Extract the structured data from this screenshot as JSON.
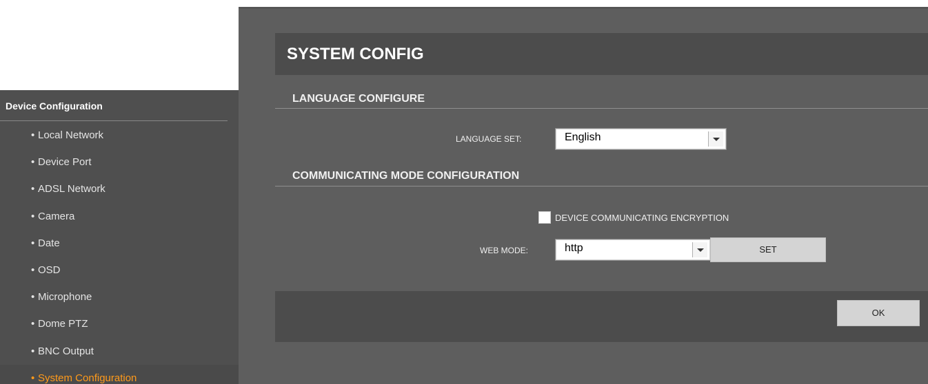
{
  "sidebar": {
    "title": "Device Configuration",
    "bullet": "•",
    "items": [
      {
        "label": "Local Network"
      },
      {
        "label": "Device Port"
      },
      {
        "label": "ADSL Network"
      },
      {
        "label": "Camera"
      },
      {
        "label": "Date"
      },
      {
        "label": "OSD"
      },
      {
        "label": "Microphone"
      },
      {
        "label": "Dome PTZ"
      },
      {
        "label": "BNC Output"
      },
      {
        "label": "System Configuration",
        "active": true
      }
    ]
  },
  "main": {
    "title": "SYSTEM CONFIG",
    "language_section": {
      "title": "LANGUAGE CONFIGURE",
      "language_label": "LANGUAGE SET:",
      "language_value": "English"
    },
    "comm_section": {
      "title": "COMMUNICATING MODE CONFIGURATION",
      "encryption_label": "DEVICE COMMUNICATING ENCRYPTION",
      "encryption_checked": false,
      "web_mode_label": "WEB MODE:",
      "web_mode_value": "http",
      "set_button": "SET"
    },
    "ok_button": "OK"
  },
  "colors": {
    "sidebar_bg": "#4f4f4f",
    "panel_bg": "#5e5e5e",
    "header_bg": "#4c4c4c",
    "active_item": "#ff9a1a"
  }
}
